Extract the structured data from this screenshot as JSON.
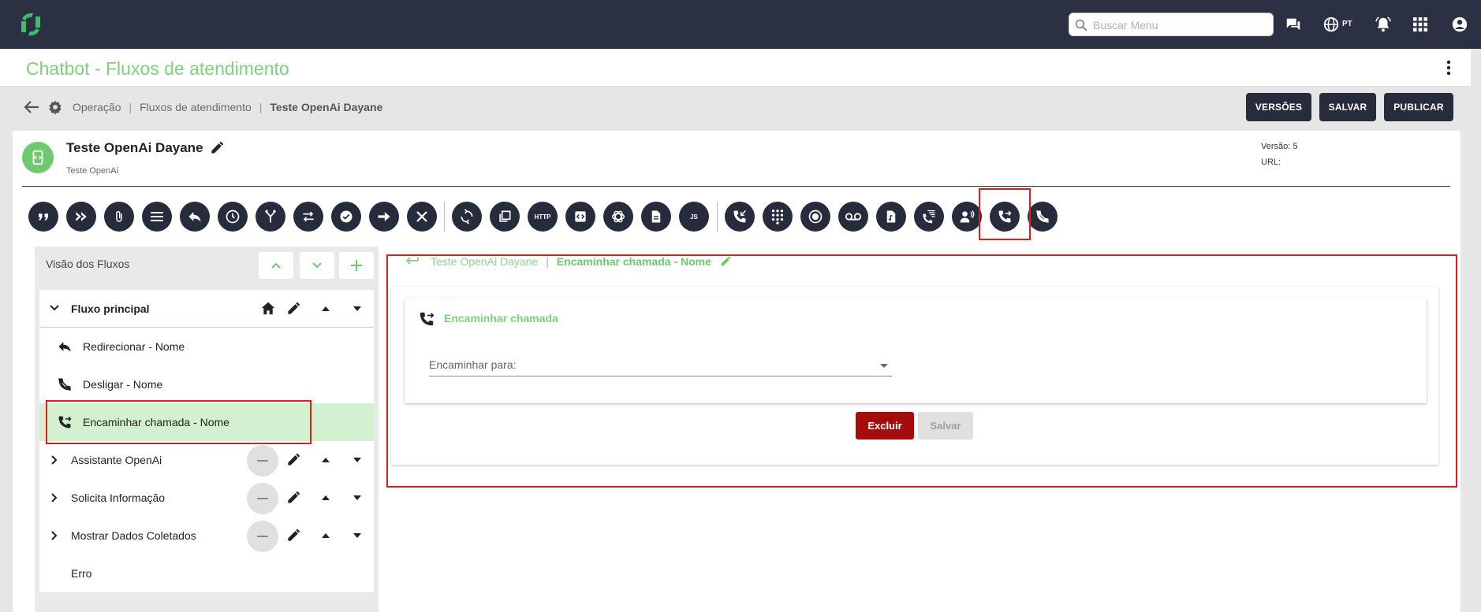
{
  "topbar": {
    "search_placeholder": "Buscar Menu",
    "language": "PT"
  },
  "header": {
    "title": "Chatbot - Fluxos de atendimento"
  },
  "breadcrumb": {
    "items": [
      "Operação",
      "Fluxos de atendimento"
    ],
    "current": "Teste OpenAi Dayane"
  },
  "actions": {
    "versions": "VERSÕES",
    "save": "SALVAR",
    "publish": "PUBLICAR"
  },
  "flow": {
    "name": "Teste OpenAi Dayane",
    "description": "Teste OpenAi",
    "version_label": "Versão: 5",
    "url_label": "URL:"
  },
  "toolbar": {
    "http_label": "HTTP",
    "js_label": "JS",
    "icons": [
      "quote-icon",
      "double-chevron-icon",
      "attachment-icon",
      "menu-icon",
      "reply-icon",
      "clock-icon",
      "branch-icon",
      "swap-icon",
      "check-icon",
      "arrow-right-icon",
      "close-icon",
      "sync-icon",
      "copy-icon",
      "http-icon",
      "code-icon",
      "openai-icon",
      "document-icon",
      "js-icon",
      "phone-incoming-icon",
      "dialpad-icon",
      "record-icon",
      "voicemail-icon",
      "audio-file-icon",
      "phone-menu-icon",
      "voice-speaker-icon",
      "phone-forward-icon",
      "phone-hangup-icon"
    ],
    "selected": "phone-forward-icon"
  },
  "flows_panel": {
    "title": "Visão dos Fluxos",
    "main_flow": "Fluxo principal",
    "main_items": [
      "Redirecionar - Nome",
      "Desligar - Nome",
      "Encaminhar chamada - Nome"
    ],
    "sub_flows": [
      "Assistante OpenAi",
      "Solicita Informação",
      "Mostrar Dados Coletados"
    ],
    "last_item": "Erro"
  },
  "editor": {
    "breadcrumb_flow": "Teste OpenAi Dayane",
    "breadcrumb_node": "Encaminhar chamada - Nome",
    "section_title": "Encaminhar chamada",
    "field_label": "Encaminhar para:",
    "field_value": "",
    "delete_button": "Excluir",
    "save_button": "Salvar"
  },
  "colors": {
    "navbar": "#2b3143",
    "accent_green": "#7ed07e",
    "dark_button": "#262c3c",
    "danger": "#a50d0d",
    "highlight_box": "#e21b1b"
  }
}
